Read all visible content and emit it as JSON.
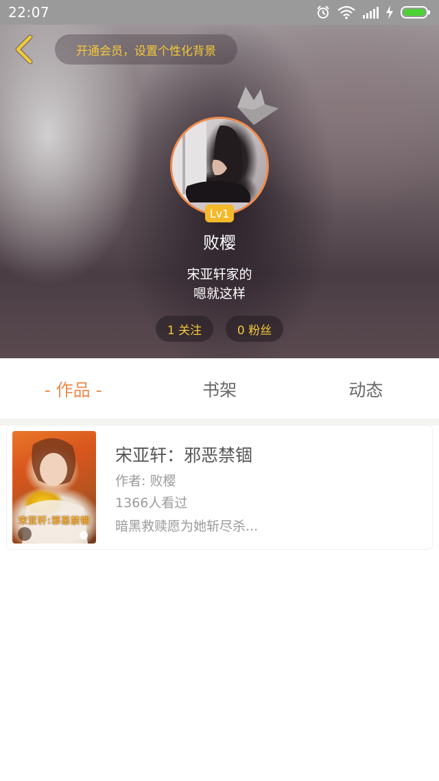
{
  "status_bar": {
    "time": "22:07",
    "icons": [
      "alarm-icon",
      "wifi-icon",
      "signal-icon",
      "charging-icon",
      "battery-icon"
    ],
    "battery_color": "#4cd137"
  },
  "header": {
    "back_icon": "chevron-left-icon",
    "vip_prompt": "开通会员，设置个性化背景"
  },
  "profile": {
    "level": "Lv1",
    "username": "败樱",
    "bio_line1": "宋亚轩家的",
    "bio_line2": "嗯就这样",
    "following": "1 关注",
    "fans": "0 粉丝"
  },
  "tabs": [
    {
      "label": "- 作品 -",
      "active": true
    },
    {
      "label": "书架",
      "active": false
    },
    {
      "label": "动态",
      "active": false
    }
  ],
  "books": [
    {
      "title": "宋亚轩：邪恶禁锢",
      "author": "作者: 败樱",
      "views": "1366人看过",
      "description": "暗黑救赎愿为她斩尽杀...",
      "cover_text": "宋亚轩:邪恶禁锢"
    }
  ],
  "colors": {
    "accent": "#f08a4b",
    "gold": "#f5c83a",
    "badge": "#f4b92a"
  }
}
